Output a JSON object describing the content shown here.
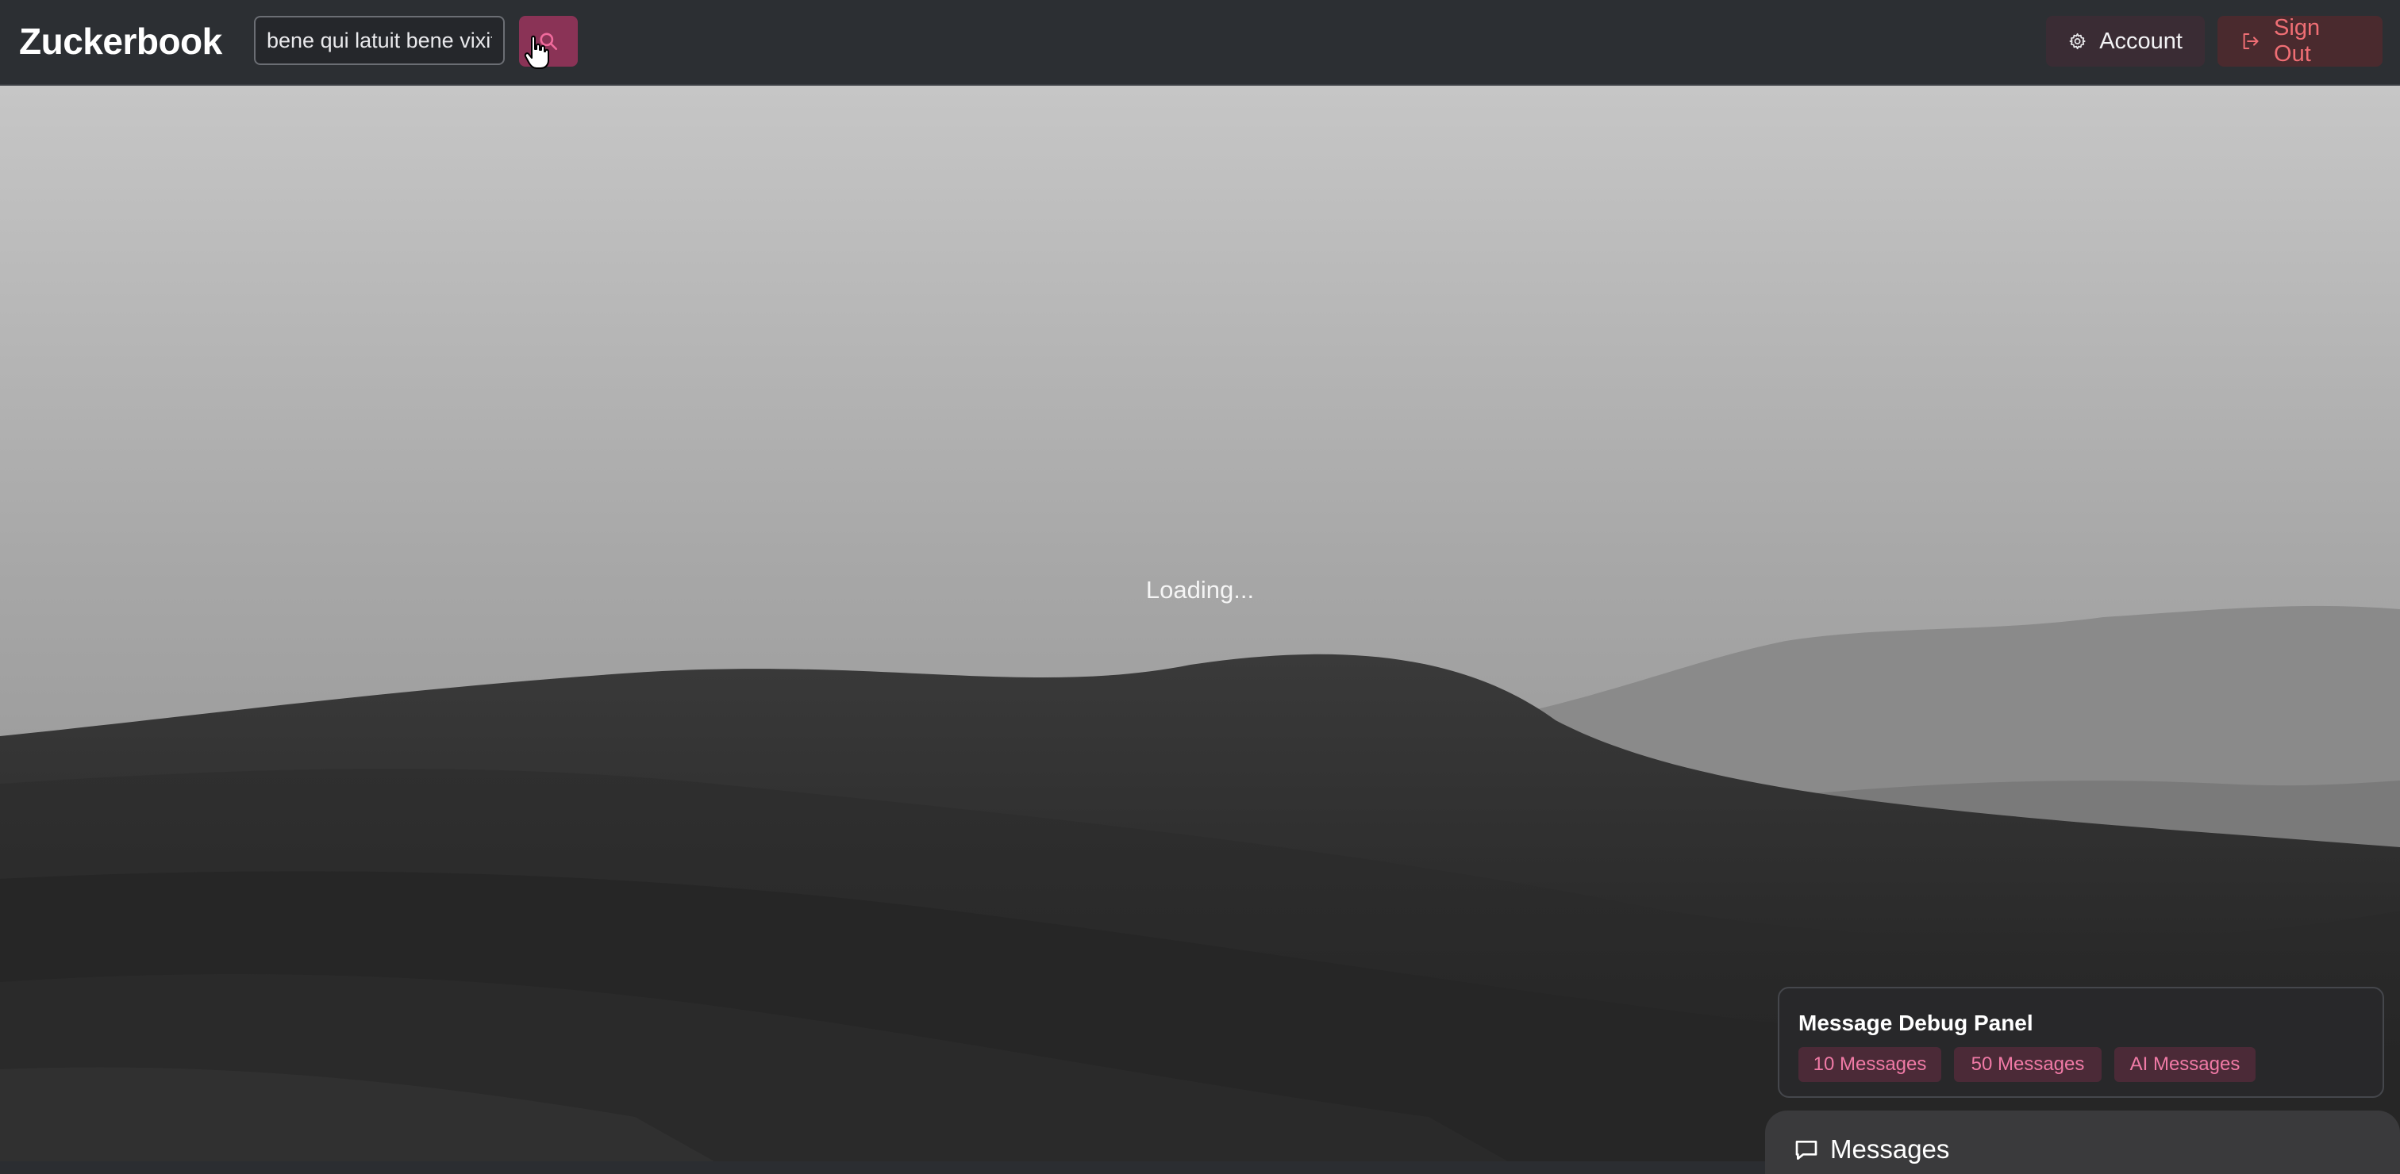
{
  "header": {
    "brand": "Zuckerbook",
    "search": {
      "value": "bene qui latuit bene vixit",
      "placeholder": ""
    },
    "search_icon": "search-icon",
    "account_label": "Account",
    "account_icon": "gear-icon",
    "signout_label": "Sign Out",
    "signout_icon": "logout-icon"
  },
  "main": {
    "status": "Loading..."
  },
  "debug_panel": {
    "title": "Message Debug Panel",
    "buttons": [
      "10 Messages",
      "50 Messages",
      "AI Messages"
    ]
  },
  "messages_dock": {
    "label": "Messages",
    "icon": "chat-bubble-icon"
  },
  "colors": {
    "header_bg": "#2c2f33",
    "accent": "#8a3356",
    "signout_text": "#ef6e74",
    "debug_btn_text": "#f07aa6"
  }
}
